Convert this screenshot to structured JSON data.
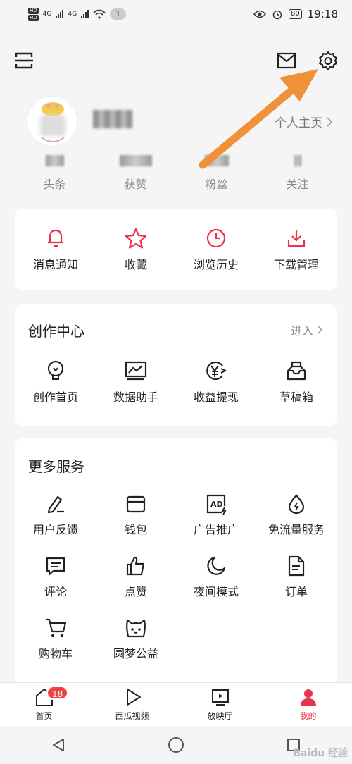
{
  "status_bar": {
    "hd1": "HD",
    "hd2": "HD",
    "net1": "4G",
    "net2": "4G",
    "notif_count": "1",
    "battery": "80",
    "time": "19:18"
  },
  "profile": {
    "homepage_link": "个人主页"
  },
  "stats": [
    {
      "label": "头条"
    },
    {
      "label": "获赞"
    },
    {
      "label": "粉丝"
    },
    {
      "label": "关注"
    }
  ],
  "quick_actions": [
    {
      "label": "消息通知",
      "icon": "bell-icon"
    },
    {
      "label": "收藏",
      "icon": "star-icon"
    },
    {
      "label": "浏览历史",
      "icon": "clock-icon"
    },
    {
      "label": "下载管理",
      "icon": "download-icon"
    }
  ],
  "creation": {
    "title": "创作中心",
    "enter": "进入",
    "items": [
      {
        "label": "创作首页",
        "icon": "lightbulb-icon"
      },
      {
        "label": "数据助手",
        "icon": "chart-icon"
      },
      {
        "label": "收益提现",
        "icon": "yen-icon"
      },
      {
        "label": "草稿箱",
        "icon": "draft-box-icon"
      }
    ]
  },
  "services": {
    "title": "更多服务",
    "items": [
      {
        "label": "用户反馈",
        "icon": "pen-icon"
      },
      {
        "label": "钱包",
        "icon": "wallet-icon"
      },
      {
        "label": "广告推广",
        "icon": "ad-icon"
      },
      {
        "label": "免流量服务",
        "icon": "drop-icon"
      },
      {
        "label": "评论",
        "icon": "comment-icon"
      },
      {
        "label": "点赞",
        "icon": "thumbs-up-icon"
      },
      {
        "label": "夜间模式",
        "icon": "moon-icon"
      },
      {
        "label": "订单",
        "icon": "order-icon"
      },
      {
        "label": "购物车",
        "icon": "cart-icon"
      },
      {
        "label": "圆梦公益",
        "icon": "cat-face-icon"
      }
    ]
  },
  "tabbar": {
    "tabs": [
      {
        "label": "首页",
        "icon": "home-icon"
      },
      {
        "label": "西瓜视频",
        "icon": "play-icon"
      },
      {
        "label": "放映厅",
        "icon": "tv-icon"
      },
      {
        "label": "我的",
        "icon": "person-icon"
      }
    ],
    "home_badge": "18"
  },
  "watermark": "Baidu 经验",
  "colors": {
    "accent": "#e8334a",
    "arrow": "#f0913a",
    "badge": "#f04142"
  }
}
